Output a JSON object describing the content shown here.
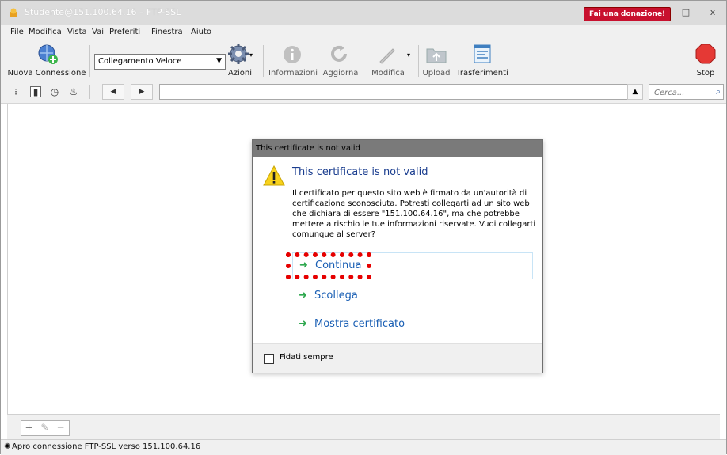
{
  "window": {
    "title": "Studente@151.100.64.16 – FTP-SSL",
    "donate_label": "Fai una donazione!",
    "maximize_glyph": "□",
    "close_glyph": "x"
  },
  "menu": [
    "File",
    "Modifica",
    "Vista",
    "Vai",
    "Preferiti",
    "Finestra",
    "Aiuto"
  ],
  "toolbar": {
    "new_connection": "Nuova Connessione",
    "quick_connect": "Collegamento Veloce",
    "actions": "Azioni",
    "info": "Informazioni",
    "refresh": "Aggiorna",
    "edit": "Modifica",
    "upload": "Upload",
    "transfers": "Trasferimenti",
    "stop": "Stop"
  },
  "navbar": {
    "path_value": "",
    "search_placeholder": "Cerca..."
  },
  "dialog": {
    "window_title": "This certificate is not valid",
    "heading": "This certificate is not valid",
    "body": "Il certificato per questo sito web è firmato da un'autorità di certificazione sconosciuta. Potresti collegarti ad un sito web che dichiara di essere \"151.100.64.16\", ma che potrebbe mettere a rischio le tue informazioni riservate. Vuoi collegarti comunque al server?",
    "commands": [
      "Continua",
      "Scollega",
      "Mostra certificato"
    ],
    "checkbox_label": "Fidati sempre",
    "checkbox_checked": false
  },
  "status": {
    "text": "Apro connessione FTP-SSL verso 151.100.64.16"
  },
  "colors": {
    "accent_link": "#1a5fb4",
    "arrow_green": "#2fa84f",
    "donate_red": "#c8102e",
    "highlight_red": "#e60000"
  }
}
